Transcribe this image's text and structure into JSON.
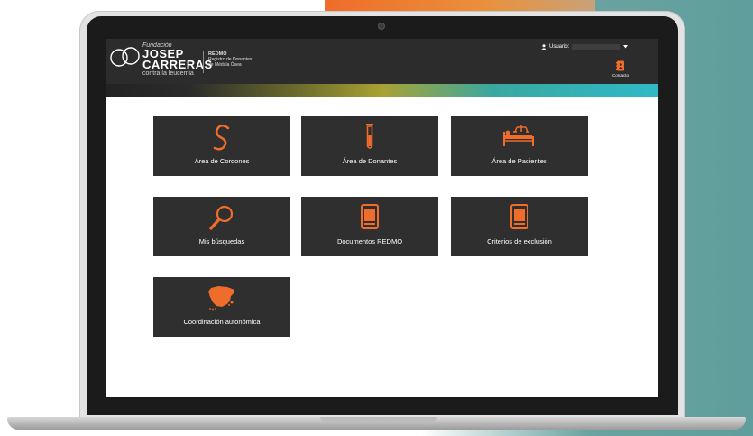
{
  "header": {
    "logo_small": "Fundación",
    "logo_line1": "JOSEP",
    "logo_line2": "CARRERAS",
    "logo_sub": "contra la leucemia",
    "redmo_title": "REDMO",
    "redmo_line1": "Registro de Donantes",
    "redmo_line2": "de Médula Ósea",
    "user_label": "Usuario:",
    "contact_label": "Contacto"
  },
  "tiles": [
    {
      "label": "Área de Cordones",
      "icon": "cord-icon"
    },
    {
      "label": "Área de Donantes",
      "icon": "test-tube-icon"
    },
    {
      "label": "Área de Pacientes",
      "icon": "hospital-bed-icon"
    },
    {
      "label": "Mis búsquedas",
      "icon": "magnifier-icon"
    },
    {
      "label": "Documentos REDMO",
      "icon": "document-icon"
    },
    {
      "label": "Criterios de exclusión",
      "icon": "document-icon"
    },
    {
      "label": "Coordinación autonómica",
      "icon": "spain-map-icon"
    }
  ],
  "colors": {
    "accent": "#ef6c2a",
    "tile_bg": "#2f2f2f",
    "header_bg": "#2c2c2c"
  }
}
